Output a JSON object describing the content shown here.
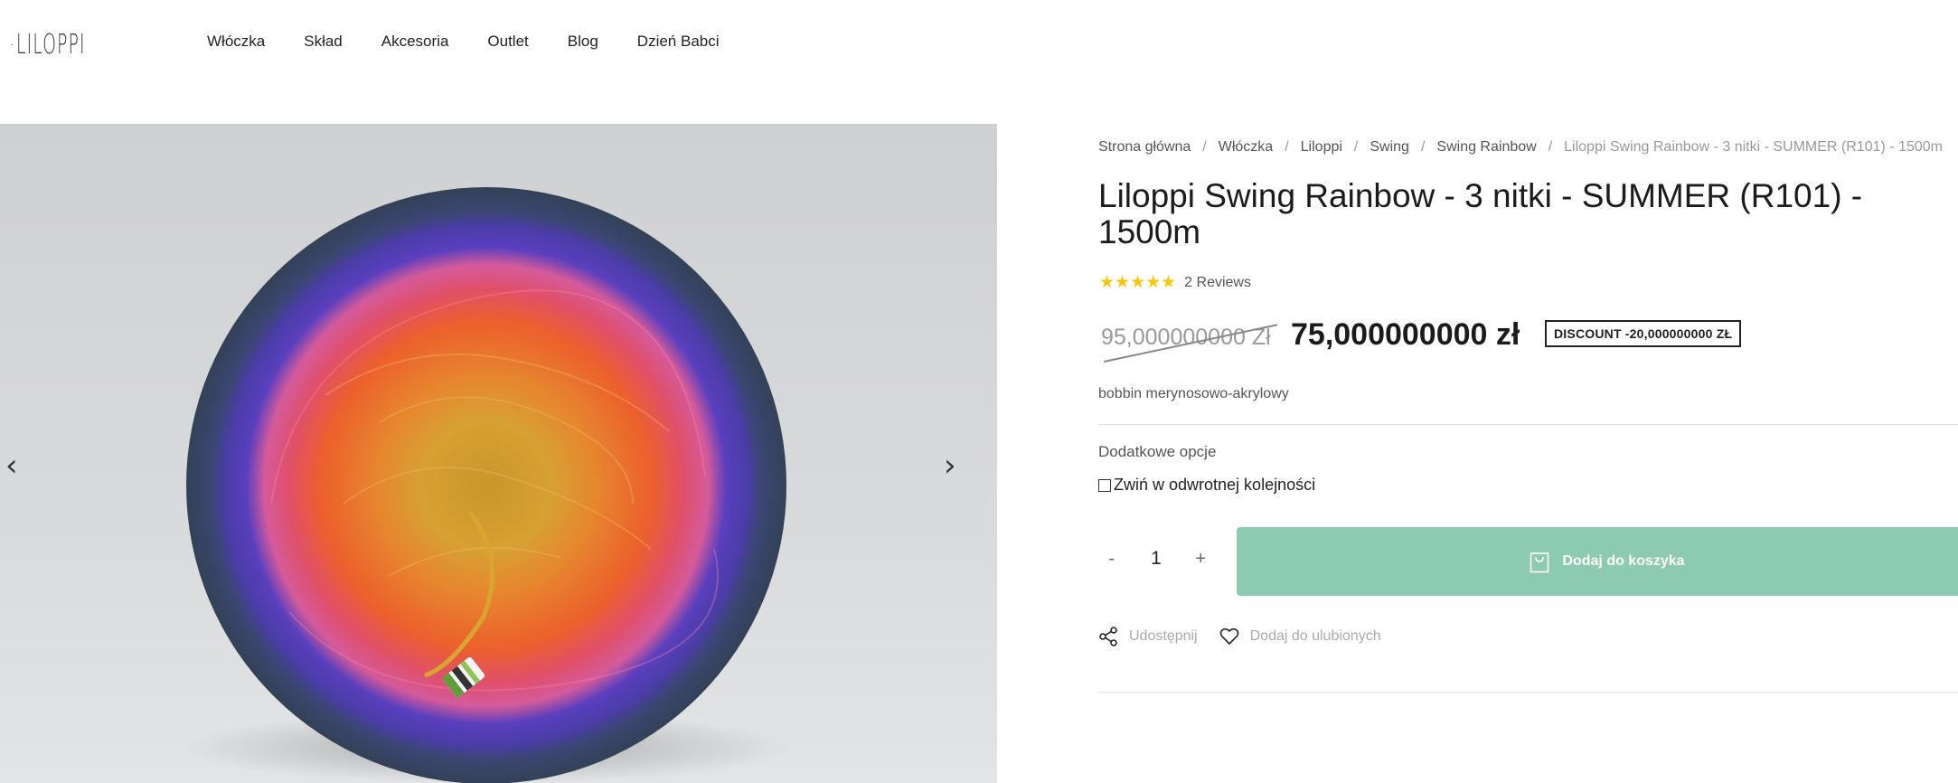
{
  "brand": {
    "logo_text": "LILOPPI"
  },
  "nav": {
    "items": [
      "Włóczka",
      "Skład",
      "Akcesoria",
      "Outlet",
      "Blog",
      "Dzień Babci"
    ]
  },
  "gallery": {
    "prev_arrow": "‹",
    "next_arrow": "›"
  },
  "breadcrumb": {
    "items": [
      "Strona główna",
      "Włóczka",
      "Liloppi",
      "Swing",
      "Swing Rainbow"
    ],
    "separator": "/",
    "current": "Liloppi Swing Rainbow - 3 nitki - SUMMER (R101) - 1500m"
  },
  "product": {
    "title": "Liloppi Swing Rainbow - 3 nitki - SUMMER (R101) - 1500m",
    "stars": "★★★★★",
    "reviews": "2 Reviews",
    "old_price": "95,000000000 Zł",
    "new_price": "75,000000000 zł",
    "discount": "DISCOUNT -20,000000000 ZŁ",
    "description": "bobbin merynosowo-akrylowy"
  },
  "options": {
    "label": "Dodatkowe opcje",
    "reverse_label": "Zwiń w odwrotnej kolejności"
  },
  "cart": {
    "minus": "-",
    "quantity": "1",
    "plus": "+",
    "add_label": "Dodaj do koszyka"
  },
  "actions": {
    "share": "Udostępnij",
    "wishlist": "Dodaj do ulubionych"
  },
  "colors": {
    "accent": "#8dcab2",
    "stars": "#f7c70a"
  }
}
